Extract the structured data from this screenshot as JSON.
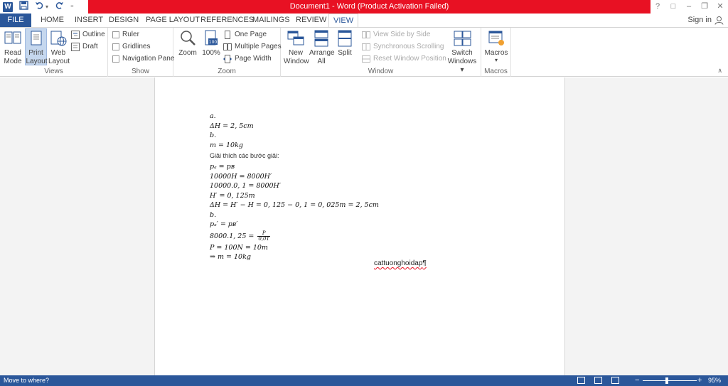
{
  "titlebar": {
    "title": "Document1 -  Word (Product Activation Failed)",
    "help": "?",
    "ribbon_options": "□",
    "minimize": "–",
    "restore": "❐",
    "close": "✕"
  },
  "qat": {
    "logo": "W",
    "save_icon": "floppy-icon",
    "undo_icon": "undo-icon",
    "redo_icon": "redo-icon",
    "customize_icon": "customize-icon"
  },
  "tabs": [
    {
      "label": "FILE"
    },
    {
      "label": "HOME"
    },
    {
      "label": "INSERT"
    },
    {
      "label": "DESIGN"
    },
    {
      "label": "PAGE LAYOUT"
    },
    {
      "label": "REFERENCES"
    },
    {
      "label": "MAILINGS"
    },
    {
      "label": "REVIEW"
    },
    {
      "label": "VIEW"
    }
  ],
  "sign_in": "Sign in",
  "ribbon": {
    "views": {
      "label": "Views",
      "read_mode": "Read Mode",
      "print_layout": "Print Layout",
      "web_layout": "Web Layout",
      "outline": "Outline",
      "draft": "Draft"
    },
    "show": {
      "label": "Show",
      "ruler": "Ruler",
      "gridlines": "Gridlines",
      "navigation_pane": "Navigation Pane"
    },
    "zoom": {
      "label": "Zoom",
      "zoom": "Zoom",
      "hundred": "100%",
      "one_page": "One Page",
      "multiple_pages": "Multiple Pages",
      "page_width": "Page Width"
    },
    "window": {
      "label": "Window",
      "new_window": "New Window",
      "arrange_all": "Arrange All",
      "split": "Split",
      "side_by_side": "View Side by Side",
      "sync_scrolling": "Synchronous Scrolling",
      "reset_position": "Reset Window Position",
      "switch_windows": "Switch Windows ▾"
    },
    "macros": {
      "label": "Macros",
      "macros": "Macros",
      "arrow": "▾"
    },
    "collapse": "∧"
  },
  "document": {
    "lines": [
      {
        "text": "a."
      },
      {
        "text": "ΔH = 2, 5cm"
      },
      {
        "text": "b."
      },
      {
        "text": "m = 10kg"
      },
      {
        "text": "Giải thích các bước giải:"
      },
      {
        "text": "pₐ = pʙ"
      },
      {
        "text": "10000H = 8000H′"
      },
      {
        "text": "10000.0, 1 = 8000H′"
      },
      {
        "text": "H′ = 0, 125m"
      },
      {
        "text": "ΔH = H′ − H = 0, 125 − 0, 1 = 0, 025m = 2, 5cm"
      },
      {
        "text": "b."
      },
      {
        "text": "pₐ′ = pʙ′"
      },
      {
        "text": "8000.1, 25 = ",
        "frac_num": "P",
        "frac_den": "0,01"
      },
      {
        "text": "P = 100N = 10m"
      },
      {
        "text": "⇒ m = 10kg"
      }
    ],
    "watermark": "cattuonghoidap",
    "pilcrow": "¶"
  },
  "statusbar": {
    "text": "Move to where?",
    "zoom_minus": "−",
    "zoom_plus": "+",
    "zoom_level": "95%"
  },
  "colors": {
    "accent": "#2b579a",
    "error_bar": "#e81123"
  }
}
